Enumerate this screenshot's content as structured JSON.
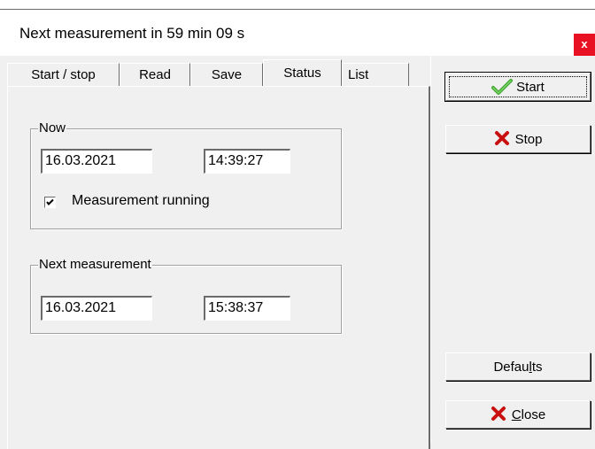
{
  "window": {
    "title": "Next measurement in  59 min 09 s",
    "close_label": "x"
  },
  "tabs": [
    {
      "label": "Start / stop",
      "active": false
    },
    {
      "label": "Read",
      "active": false
    },
    {
      "label": "Save",
      "active": false
    },
    {
      "label": "Status",
      "active": true
    },
    {
      "label": "List",
      "active": false
    }
  ],
  "now_group": {
    "legend": "Now",
    "date": "16.03.2021",
    "time": "14:39:27",
    "checkbox_label": "Measurement running",
    "checked": true
  },
  "next_group": {
    "legend": "Next measurement",
    "date": "16.03.2021",
    "time": "15:38:37"
  },
  "buttons": {
    "start": "Start",
    "stop": "Stop",
    "defaults_pre": "Defau",
    "defaults_ul": "l",
    "defaults_post": "ts",
    "close_ul": "C",
    "close_post": "lose"
  },
  "icons": {
    "start": "check-icon",
    "stop": "x-mark-icon"
  },
  "colors": {
    "check_green": "#3fa82f",
    "cross_red": "#c81010",
    "close_bg": "#e81123"
  }
}
